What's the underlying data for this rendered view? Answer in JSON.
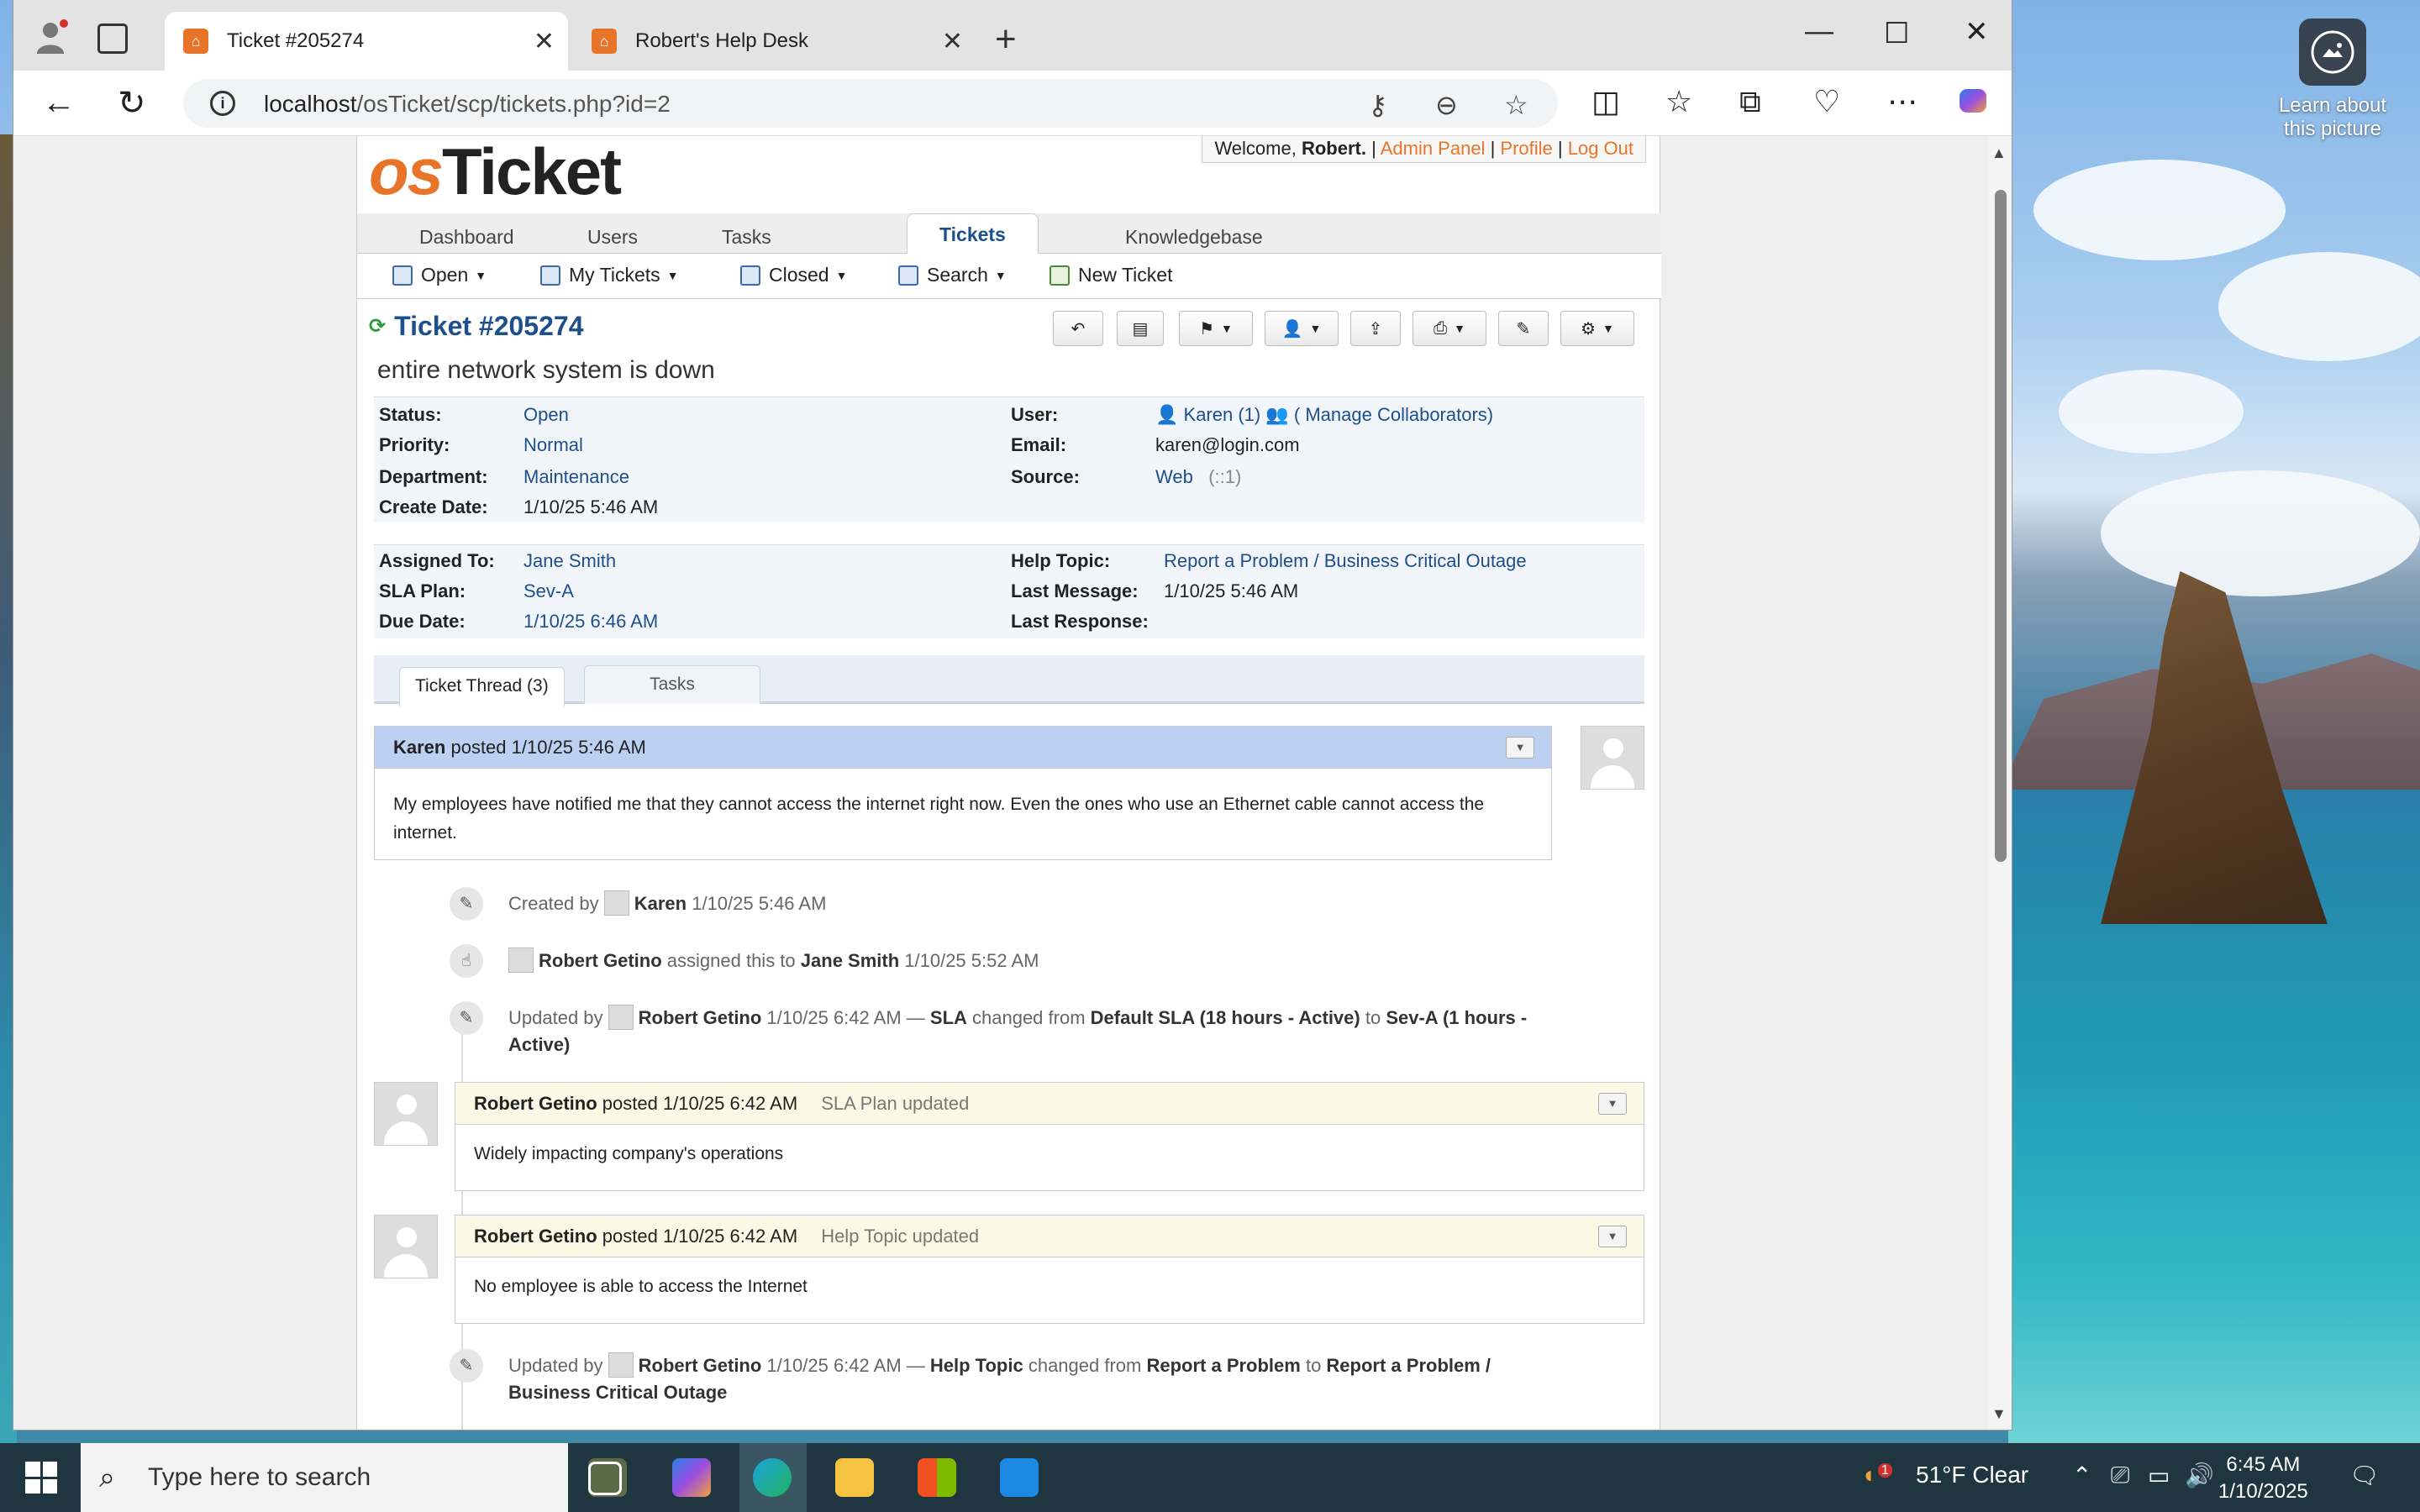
{
  "browser": {
    "tabs": [
      {
        "title": "Ticket #205274",
        "active": true
      },
      {
        "title": "Robert's Help Desk",
        "active": false
      }
    ],
    "url_host": "localhost",
    "url_path": "/osTicket/scp/tickets.php?id=2"
  },
  "desktop": {
    "learn_line1": "Learn about",
    "learn_line2": "this picture"
  },
  "header": {
    "welcome": "Welcome, ",
    "user": "Robert",
    "admin_panel": "Admin Panel",
    "profile": "Profile",
    "logout": "Log Out",
    "sep": " | ",
    "logo_o": "os",
    "logo_rest": "Ticket"
  },
  "nav": {
    "dashboard": "Dashboard",
    "users": "Users",
    "tasks": "Tasks",
    "tickets": "Tickets",
    "knowledgebase": "Knowledgebase"
  },
  "subnav": {
    "open": "Open",
    "my_tickets": "My Tickets",
    "closed": "Closed",
    "search": "Search",
    "new_ticket": "New Ticket"
  },
  "ticket": {
    "number": "Ticket #205274",
    "subject": "entire network system is down",
    "status_label": "Status:",
    "status": "Open",
    "priority_label": "Priority:",
    "priority": "Normal",
    "department_label": "Department:",
    "department": "Maintenance",
    "create_label": "Create Date:",
    "create_date": "1/10/25 5:46 AM",
    "user_label": "User:",
    "user": "Karen (1)",
    "collab": "( Manage Collaborators)",
    "email_label": "Email:",
    "email": "karen@login.com",
    "source_label": "Source:",
    "source": "Web",
    "source_ip": "(::1)",
    "assigned_label": "Assigned To:",
    "assigned": "Jane Smith",
    "sla_label": "SLA Plan:",
    "sla": "Sev-A",
    "due_label": "Due Date:",
    "due": "1/10/25 6:46 AM",
    "topic_label": "Help Topic:",
    "topic": "Report a Problem / Business Critical Outage",
    "lastmsg_label": "Last Message:",
    "lastmsg": "1/10/25 5:46 AM",
    "lastresp_label": "Last Response:",
    "lastresp": ""
  },
  "thread_tabs": {
    "thread": "Ticket Thread (3)",
    "tasks": "Tasks"
  },
  "thread": {
    "e1_author": "Karen",
    "e1_posted": " posted 1/10/25 5:46 AM",
    "e1_body": "My employees have notified me that they cannot access the internet right now. Even the ones who use an Ethernet cable cannot access the internet.",
    "ev1_pre": "Created by ",
    "ev1_user": "Karen",
    "ev1_time": " 1/10/25 5:46 AM",
    "ev2_user": "Robert Getino",
    "ev2_mid": " assigned this to ",
    "ev2_target": "Jane Smith",
    "ev2_time": " 1/10/25 5:52 AM",
    "ev3_pre": "Updated by ",
    "ev3_user": "Robert Getino",
    "ev3_time": " 1/10/25 6:42 AM — ",
    "ev3_field": "SLA",
    "ev3_mid": " changed from ",
    "ev3_from": "Default SLA (18 hours - Active)",
    "ev3_to_word": " to ",
    "ev3_to": "Sev-A (1 hours - Active)",
    "e2_author": "Robert Getino",
    "e2_posted": " posted 1/10/25 6:42 AM",
    "e2_note": "SLA Plan updated",
    "e2_body": "Widely impacting company's operations",
    "e3_author": "Robert Getino",
    "e3_posted": " posted 1/10/25 6:42 AM",
    "e3_note": "Help Topic updated",
    "e3_body": "No employee is able to access the Internet",
    "ev4_pre": "Updated by ",
    "ev4_user": "Robert Getino",
    "ev4_time": " 1/10/25 6:42 AM — ",
    "ev4_field": "Help Topic",
    "ev4_mid": " changed from ",
    "ev4_from": "Report a Problem",
    "ev4_to_word": " to ",
    "ev4_to": "Report a Problem / Business Critical Outage"
  },
  "taskbar": {
    "search_placeholder": "Type here to search",
    "weather": "51°F  Clear",
    "weather_badge": "1",
    "time": "6:45 AM",
    "date": "1/10/2025"
  }
}
